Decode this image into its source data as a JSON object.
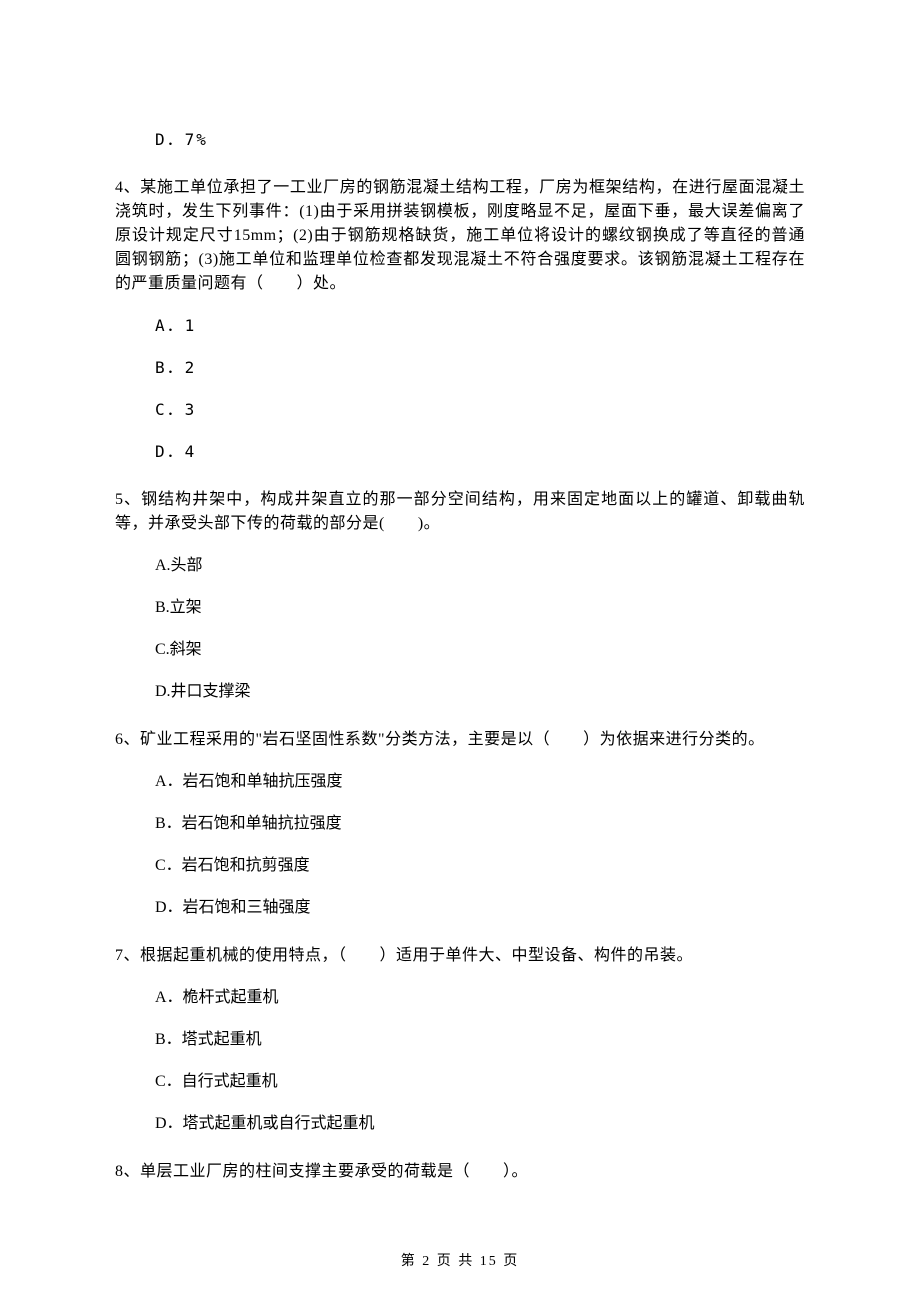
{
  "q3": {
    "optD": "D．7%"
  },
  "q4": {
    "stem": "4、某施工单位承担了一工业厂房的钢筋混凝土结构工程，厂房为框架结构，在进行屋面混凝土浇筑时，发生下列事件：(1)由于采用拼装钢模板，刚度略显不足，屋面下垂，最大误差偏离了原设计规定尺寸15mm；(2)由于钢筋规格缺货，施工单位将设计的螺纹钢换成了等直径的普通圆钢钢筋；(3)施工单位和监理单位检查都发现混凝土不符合强度要求。该钢筋混凝土工程存在的严重质量问题有（　　）处。",
    "optA": "A．1",
    "optB": "B．2",
    "optC": "C．3",
    "optD": "D．4"
  },
  "q5": {
    "stem": "5、钢结构井架中，构成井架直立的那一部分空间结构，用来固定地面以上的罐道、卸载曲轨等，并承受头部下传的荷载的部分是(　　)。",
    "optA": "A.头部",
    "optB": "B.立架",
    "optC": "C.斜架",
    "optD": "D.井口支撑梁"
  },
  "q6": {
    "stem": "6、矿业工程采用的\"岩石坚固性系数\"分类方法，主要是以（　　）为依据来进行分类的。",
    "optA": "A．岩石饱和单轴抗压强度",
    "optB": "B．岩石饱和单轴抗拉强度",
    "optC": "C．岩石饱和抗剪强度",
    "optD": "D．岩石饱和三轴强度"
  },
  "q7": {
    "stem": "7、根据起重机械的使用特点，（　　）适用于单件大、中型设备、构件的吊装。",
    "optA": "A．桅杆式起重机",
    "optB": "B．塔式起重机",
    "optC": "C．自行式起重机",
    "optD": "D．塔式起重机或自行式起重机"
  },
  "q8": {
    "stem": "8、单层工业厂房的柱间支撑主要承受的荷载是（　　）。"
  },
  "footer": "第 2 页 共 15 页"
}
